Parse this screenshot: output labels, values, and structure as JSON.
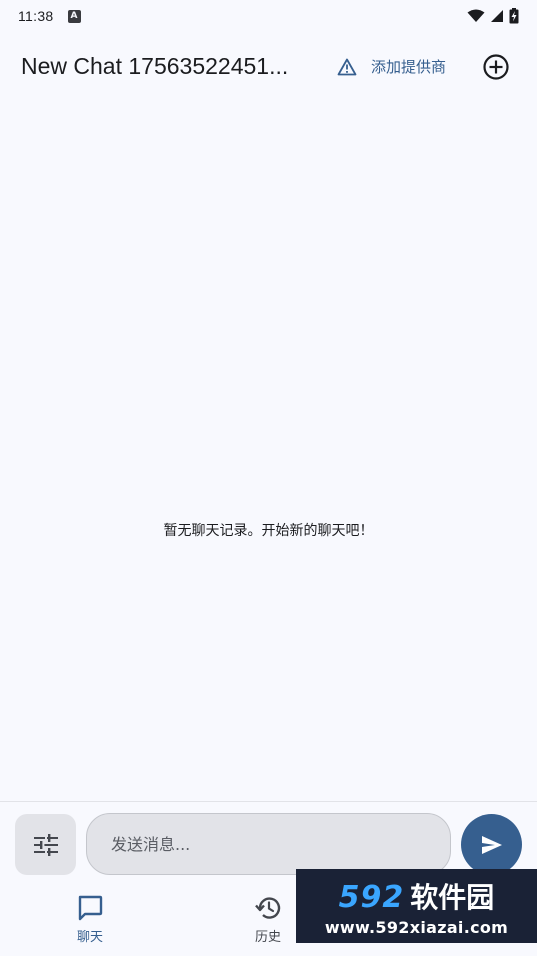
{
  "status_bar": {
    "time": "11:38",
    "notification_icon": "a-box-icon",
    "wifi_icon": "wifi-icon",
    "signal_icon": "signal-icon",
    "battery_icon": "battery-charging-icon"
  },
  "app_bar": {
    "title": "New Chat 17563522451...",
    "provider_warning_label": "添加提供商",
    "warning_icon": "warning-triangle-icon",
    "add_icon": "add-circle-icon"
  },
  "chat": {
    "empty_message": "暂无聊天记录。开始新的聊天吧！"
  },
  "input": {
    "settings_icon": "tune-sliders-icon",
    "placeholder": "发送消息...",
    "send_icon": "send-icon"
  },
  "bottom_nav": {
    "items": [
      {
        "label": "聊天",
        "icon": "chat-bubble-icon",
        "active": true
      },
      {
        "label": "历史",
        "icon": "history-icon",
        "active": false
      }
    ]
  },
  "watermark": {
    "brand_number": "592",
    "brand_text": "软件园",
    "url": "www.592xiazai.com"
  },
  "colors": {
    "background": "#f8f9fe",
    "accent": "#365f8f",
    "surface": "#e2e3e8"
  }
}
